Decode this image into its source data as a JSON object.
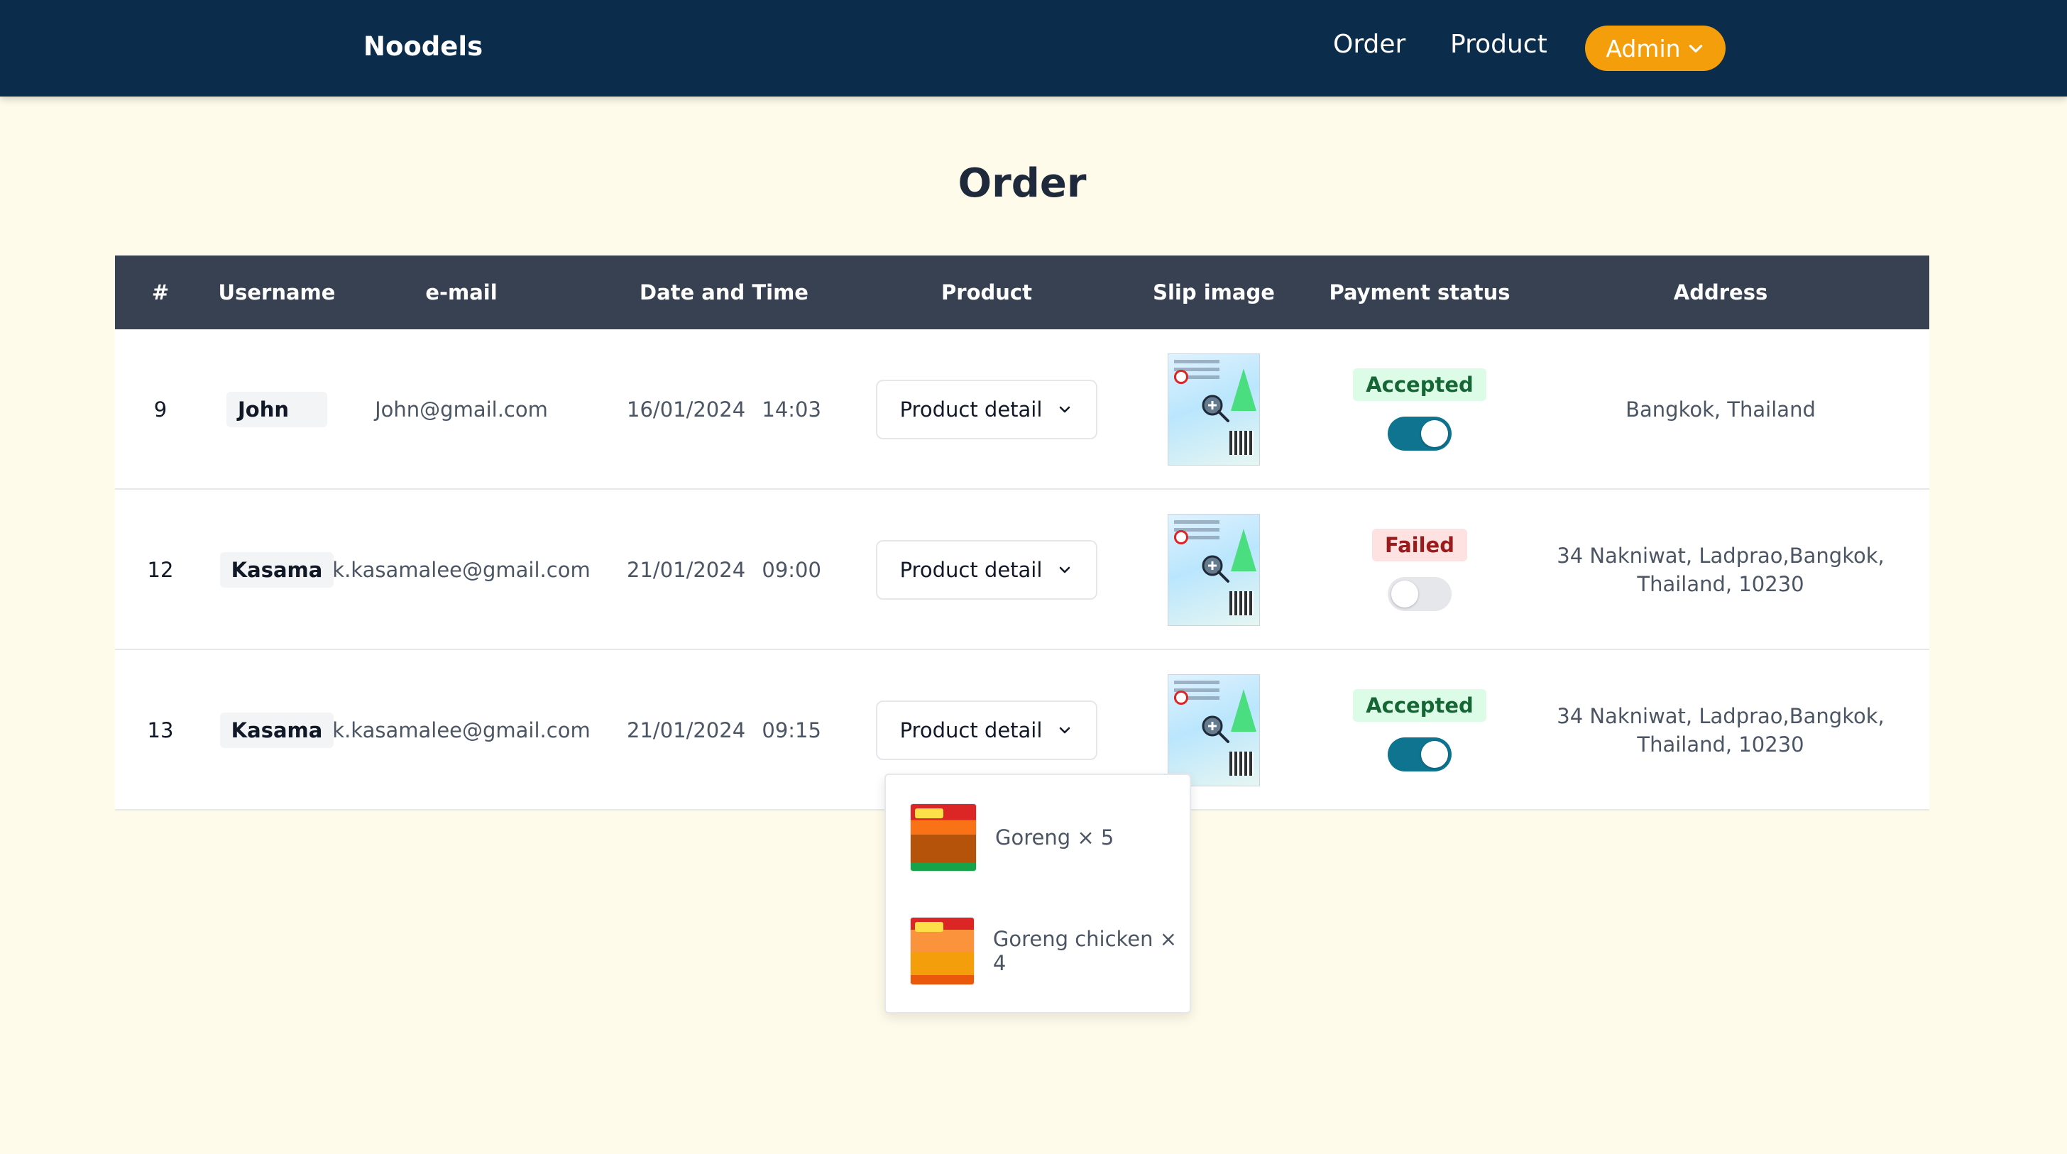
{
  "navbar": {
    "brand": "Noodels",
    "links": {
      "order": "Order",
      "product": "Product"
    },
    "admin": {
      "label": "Admin",
      "icon": "chevron-down-icon"
    },
    "background": "#0b2c4a",
    "accent": "#f59e0b"
  },
  "page": {
    "title": "Order",
    "background": "#fefbeb"
  },
  "table": {
    "headers": [
      "#",
      "Username",
      "e-mail",
      "Date and Time",
      "Product",
      "Slip image",
      "Payment status",
      "Address"
    ],
    "rows": [
      {
        "id": "9",
        "username": "John",
        "email": "John@gmail.com",
        "datetime": "16/01/2024 14:03",
        "product_button": "Product detail",
        "payment_status": "Accepted",
        "paid": true,
        "address": "Bangkok, Thailand"
      },
      {
        "id": "12",
        "username": "Kasama",
        "email": "k.kasamalee@gmail.com",
        "datetime": "21/01/2024 09:00",
        "product_button": "Product detail",
        "payment_status": "Failed",
        "paid": false,
        "address": "34 Nakniwat, Ladprao,Bangkok, Thailand, 10230"
      },
      {
        "id": "13",
        "username": "Kasama",
        "email": "k.kasamalee@gmail.com",
        "datetime": "21/01/2024 09:15",
        "product_button": "Product detail",
        "payment_status": "Accepted",
        "paid": true,
        "address": "34 Nakniwat, Ladprao,Bangkok, Thailand, 10230"
      }
    ]
  },
  "dropdown": {
    "items": [
      {
        "label": "Goreng × 5"
      },
      {
        "label": "Goreng chicken × 4"
      }
    ]
  },
  "colors": {
    "header_bg": "#374151",
    "toggle_on": "#0e7490",
    "accepted_bg": "#dcfce7",
    "accepted_text": "#166534",
    "failed_bg": "#fee2e2",
    "failed_text": "#991b1b"
  }
}
